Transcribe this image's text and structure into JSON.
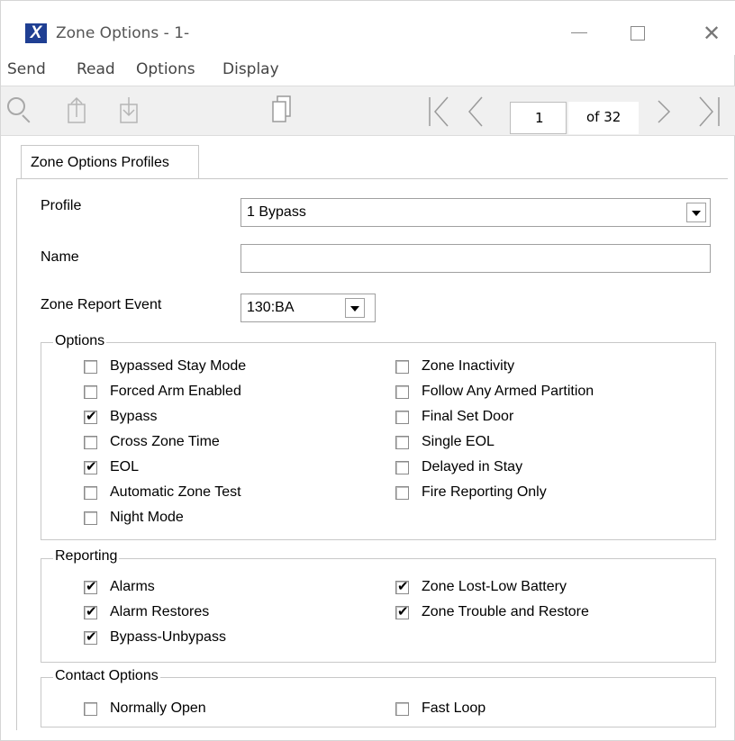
{
  "window": {
    "title": "Zone Options - 1-",
    "app_icon_glyph": "X",
    "close_glyph": "✕"
  },
  "menu": [
    "Send",
    "Read",
    "Options",
    "Display"
  ],
  "toolbar": {
    "icons": [
      "search-icon",
      "send-icon",
      "read-icon",
      "copy-icon",
      "first-page-icon",
      "previous-page-icon",
      "next-page-icon",
      "last-page-icon"
    ],
    "page_current": "1",
    "page_total_label": "of 32"
  },
  "tabs": [
    "Zone Options Profiles"
  ],
  "form": {
    "profile_label": "Profile",
    "profile_value": "1 Bypass",
    "name_label": "Name",
    "name_value": "",
    "zone_report_event_label": "Zone Report Event",
    "zone_report_event_value": "130:BA"
  },
  "options": {
    "legend": "Options",
    "left": [
      {
        "label": "Bypassed Stay Mode",
        "checked": false
      },
      {
        "label": "Forced Arm Enabled",
        "checked": false
      },
      {
        "label": "Bypass",
        "checked": true
      },
      {
        "label": "Cross Zone Time",
        "checked": false
      },
      {
        "label": "EOL",
        "checked": true
      },
      {
        "label": "Automatic Zone Test",
        "checked": false
      },
      {
        "label": "Night Mode",
        "checked": false
      }
    ],
    "right": [
      {
        "label": "Zone Inactivity",
        "checked": false
      },
      {
        "label": "Follow Any Armed Partition",
        "checked": false
      },
      {
        "label": "Final Set Door",
        "checked": false
      },
      {
        "label": "Single EOL",
        "checked": false
      },
      {
        "label": "Delayed in Stay",
        "checked": false
      },
      {
        "label": "Fire Reporting Only",
        "checked": false
      }
    ]
  },
  "reporting": {
    "legend": "Reporting",
    "left": [
      {
        "label": "Alarms",
        "checked": true
      },
      {
        "label": "Alarm Restores",
        "checked": true
      },
      {
        "label": "Bypass-Unbypass",
        "checked": true
      }
    ],
    "right": [
      {
        "label": "Zone Lost-Low Battery",
        "checked": true
      },
      {
        "label": "Zone Trouble and Restore",
        "checked": true
      }
    ]
  },
  "contact": {
    "legend": "Contact Options",
    "left": [
      {
        "label": "Normally Open",
        "checked": false
      }
    ],
    "right": [
      {
        "label": "Fast Loop",
        "checked": false
      }
    ]
  },
  "check_glyph": "✔"
}
